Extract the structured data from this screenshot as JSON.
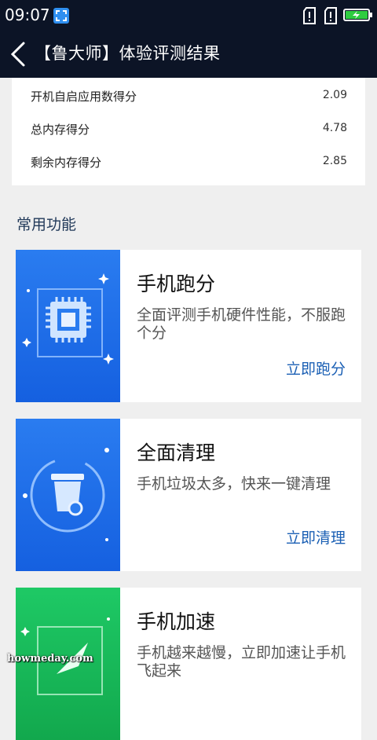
{
  "status_bar": {
    "time": "09:07"
  },
  "header": {
    "title": "【鲁大师】体验评测结果"
  },
  "scores": [
    {
      "label": "开机自启应用数得分",
      "value": "2.09"
    },
    {
      "label": "总内存得分",
      "value": "4.78"
    },
    {
      "label": "剩余内存得分",
      "value": "2.85"
    }
  ],
  "section": {
    "title": "常用功能"
  },
  "features": [
    {
      "title": "手机跑分",
      "desc": "全面评测手机硬件性能，不服跑个分",
      "action": "立即跑分",
      "icon": "cpu-icon",
      "color": "#1f6ee8"
    },
    {
      "title": "全面清理",
      "desc": "手机垃圾太多，快来一键清理",
      "action": "立即清理",
      "icon": "trash-icon",
      "color": "#1f6ee8"
    },
    {
      "title": "手机加速",
      "desc": "手机越来越慢，立即加速让手机飞起来",
      "action": "",
      "icon": "rocket-icon",
      "color": "#19b85a"
    }
  ],
  "watermark": "howmeday.com"
}
